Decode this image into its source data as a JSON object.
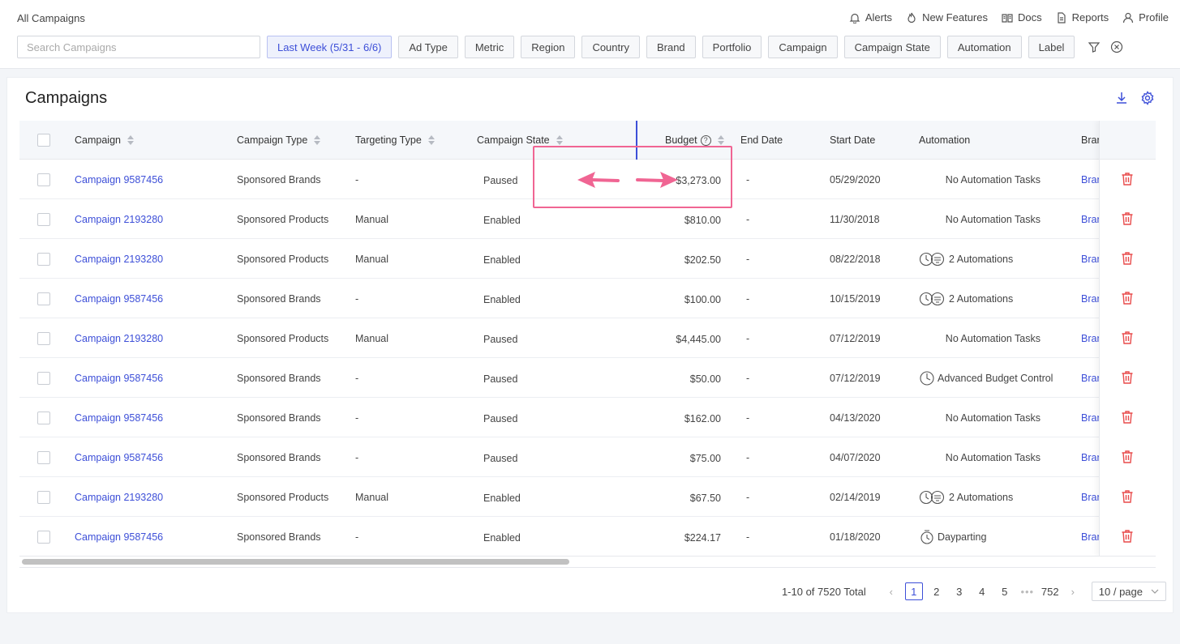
{
  "breadcrumb": "All Campaigns",
  "topnav": [
    {
      "label": "Alerts",
      "icon": "bell-icon"
    },
    {
      "label": "New Features",
      "icon": "flame-icon"
    },
    {
      "label": "Docs",
      "icon": "book-icon"
    },
    {
      "label": "Reports",
      "icon": "document-icon"
    },
    {
      "label": "Profile",
      "icon": "user-icon"
    }
  ],
  "search": {
    "placeholder": "Search Campaigns",
    "value": ""
  },
  "filters": [
    "Last Week (5/31 - 6/6)",
    "Ad Type",
    "Metric",
    "Region",
    "Country",
    "Brand",
    "Portfolio",
    "Campaign",
    "Campaign State",
    "Automation",
    "Label"
  ],
  "panel_title": "Campaigns",
  "columns": {
    "campaign": "Campaign",
    "campaign_type": "Campaign Type",
    "targeting_type": "Targeting Type",
    "campaign_state": "Campaign State",
    "budget": "Budget",
    "end_date": "End Date",
    "start_date": "Start Date",
    "automation": "Automation",
    "brand": "Bran"
  },
  "rows": [
    {
      "campaign": "Campaign 9587456",
      "type": "Sponsored Brands",
      "targeting": "-",
      "state": "Paused",
      "budget": "$3,273.00",
      "end": "-",
      "start": "05/29/2020",
      "automation": "No Automation Tasks",
      "auto_icon": "none",
      "brand": "Bran"
    },
    {
      "campaign": "Campaign 2193280",
      "type": "Sponsored Products",
      "targeting": "Manual",
      "state": "Enabled",
      "budget": "$810.00",
      "end": "-",
      "start": "11/30/2018",
      "automation": "No Automation Tasks",
      "auto_icon": "none",
      "brand": "Bran"
    },
    {
      "campaign": "Campaign 2193280",
      "type": "Sponsored Products",
      "targeting": "Manual",
      "state": "Enabled",
      "budget": "$202.50",
      "end": "-",
      "start": "08/22/2018",
      "automation": "2 Automations",
      "auto_icon": "double",
      "brand": "Bran"
    },
    {
      "campaign": "Campaign 9587456",
      "type": "Sponsored Brands",
      "targeting": "-",
      "state": "Enabled",
      "budget": "$100.00",
      "end": "-",
      "start": "10/15/2019",
      "automation": "2 Automations",
      "auto_icon": "double",
      "brand": "Bran"
    },
    {
      "campaign": "Campaign 2193280",
      "type": "Sponsored Products",
      "targeting": "Manual",
      "state": "Paused",
      "budget": "$4,445.00",
      "end": "-",
      "start": "07/12/2019",
      "automation": "No Automation Tasks",
      "auto_icon": "none",
      "brand": "Bran"
    },
    {
      "campaign": "Campaign 9587456",
      "type": "Sponsored Brands",
      "targeting": "-",
      "state": "Paused",
      "budget": "$50.00",
      "end": "-",
      "start": "07/12/2019",
      "automation": "Advanced Budget Control",
      "auto_icon": "budget",
      "brand": "Bran"
    },
    {
      "campaign": "Campaign 9587456",
      "type": "Sponsored Brands",
      "targeting": "-",
      "state": "Paused",
      "budget": "$162.00",
      "end": "-",
      "start": "04/13/2020",
      "automation": "No Automation Tasks",
      "auto_icon": "none",
      "brand": "Bran"
    },
    {
      "campaign": "Campaign 9587456",
      "type": "Sponsored Brands",
      "targeting": "-",
      "state": "Paused",
      "budget": "$75.00",
      "end": "-",
      "start": "04/07/2020",
      "automation": "No Automation Tasks",
      "auto_icon": "none",
      "brand": "Bran"
    },
    {
      "campaign": "Campaign 2193280",
      "type": "Sponsored Products",
      "targeting": "Manual",
      "state": "Enabled",
      "budget": "$67.50",
      "end": "-",
      "start": "02/14/2019",
      "automation": "2 Automations",
      "auto_icon": "double",
      "brand": "Bran"
    },
    {
      "campaign": "Campaign 9587456",
      "type": "Sponsored Brands",
      "targeting": "-",
      "state": "Enabled",
      "budget": "$224.17",
      "end": "-",
      "start": "01/18/2020",
      "automation": "Dayparting",
      "auto_icon": "clock",
      "brand": "Bran"
    }
  ],
  "pagination": {
    "total": "1-10 of 7520 Total",
    "pages": [
      "1",
      "2",
      "3",
      "4",
      "5"
    ],
    "dots": "•••",
    "last": "752",
    "page_size": "10 / page"
  },
  "colors": {
    "accent": "#3d4fd8",
    "annotation": "#f06593",
    "delete": "#e84a4a"
  }
}
